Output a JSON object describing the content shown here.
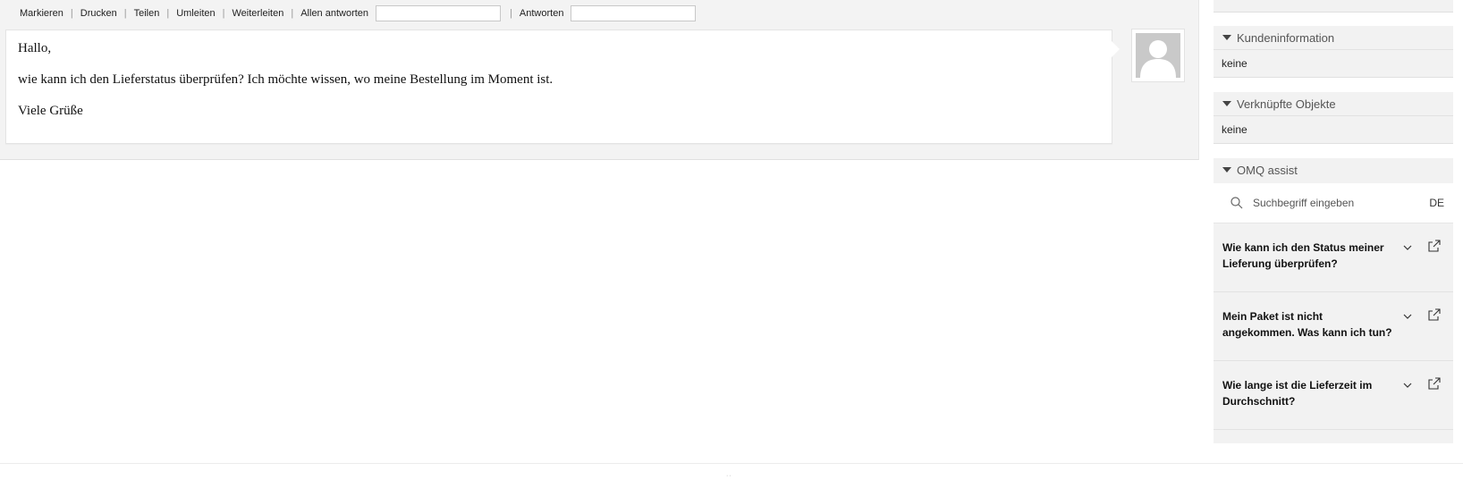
{
  "toolbar": {
    "links": [
      "Markieren",
      "Drucken",
      "Teilen",
      "Umleiten",
      "Weiterleiten"
    ],
    "reply_all_label": "Allen antworten",
    "reply_label": "Antworten"
  },
  "message": {
    "greeting": "Hallo,",
    "body": "wie kann ich den Lieferstatus überprüfen? Ich möchte wissen, wo meine Bestellung im Moment ist.",
    "closing": "Viele Grüße"
  },
  "sidebar": {
    "customer_info": {
      "title": "Kundeninformation",
      "value": "keine"
    },
    "linked_objects": {
      "title": "Verknüpfte Objekte",
      "value": "keine"
    },
    "omq": {
      "title": "OMQ assist",
      "search_placeholder": "Suchbegriff eingeben",
      "language": "DE",
      "questions": [
        "Wie kann ich den Status meiner Lieferung überprüfen?",
        "Mein Paket ist nicht angekommen. Was kann ich tun?",
        "Wie lange ist die Lieferzeit im Durchschnitt?"
      ]
    }
  },
  "colors": {
    "panel_bg": "#f3f3f3",
    "sidebar_bg": "#f2f2f2",
    "border": "#e0e0e0"
  },
  "icons": [
    "avatar-placeholder-icon",
    "caret-down-icon",
    "search-icon",
    "chevron-down-icon",
    "external-link-icon"
  ]
}
